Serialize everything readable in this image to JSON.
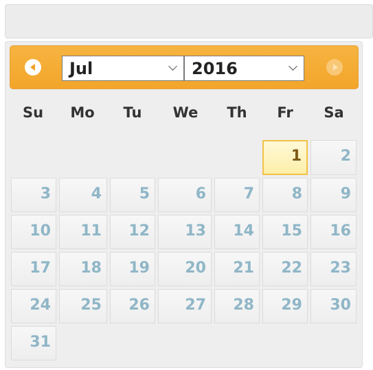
{
  "navigation": {
    "prev_icon": "prev-arrow-icon",
    "next_icon": "next-arrow-icon"
  },
  "selects": {
    "month": "Jul",
    "year": "2016"
  },
  "weekdays": [
    "Su",
    "Mo",
    "Tu",
    "We",
    "Th",
    "Fr",
    "Sa"
  ],
  "days": [
    "1",
    "2",
    "3",
    "4",
    "5",
    "6",
    "7",
    "8",
    "9",
    "10",
    "11",
    "12",
    "13",
    "14",
    "15",
    "16",
    "17",
    "18",
    "19",
    "20",
    "21",
    "22",
    "23",
    "24",
    "25",
    "26",
    "27",
    "28",
    "29",
    "30",
    "31"
  ],
  "colors": {
    "header_accent": "#f3a52a",
    "day_text": "#8fb6c7",
    "today_bg": "#fcefa8",
    "today_border": "#f2c148"
  }
}
